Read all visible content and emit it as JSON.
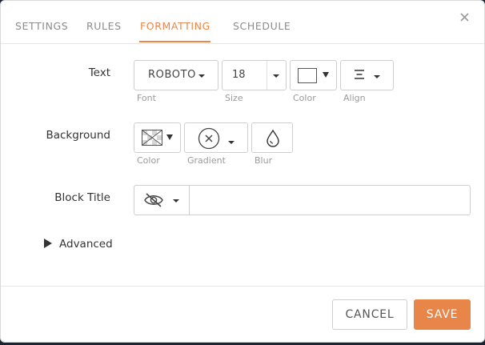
{
  "tabs": [
    {
      "label": "SETTINGS"
    },
    {
      "label": "RULES"
    },
    {
      "label": "FORMATTING"
    },
    {
      "label": "SCHEDULE"
    }
  ],
  "active_tab": "FORMATTING",
  "accent_color": "#e8864a",
  "text_row": {
    "label": "Text",
    "font_value": "ROBOTO",
    "font_caption": "Font",
    "size_value": "18",
    "size_caption": "Size",
    "color_caption": "Color",
    "align_caption": "Align"
  },
  "background_row": {
    "label": "Background",
    "color_caption": "Color",
    "gradient_caption": "Gradient",
    "blur_caption": "Blur"
  },
  "block_title_row": {
    "label": "Block Title",
    "visibility_icon": "eye-slash-icon",
    "title_value": ""
  },
  "advanced": {
    "label": "Advanced"
  },
  "footer": {
    "cancel_label": "CANCEL",
    "save_label": "SAVE"
  }
}
